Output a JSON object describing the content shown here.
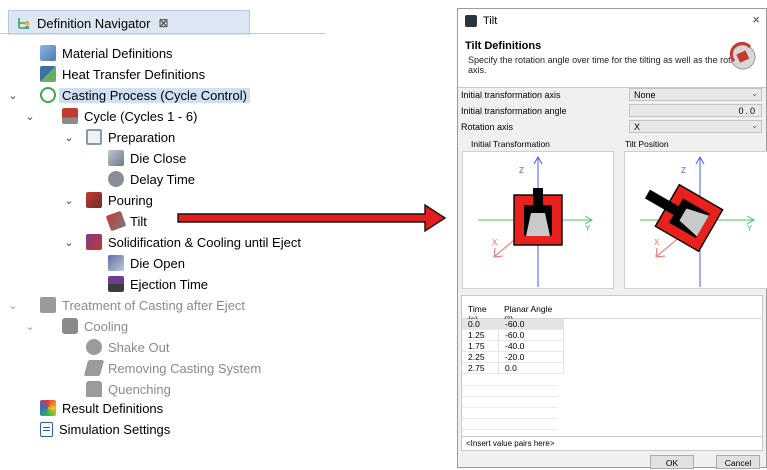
{
  "navigator": {
    "tab_title": "Definition Navigator",
    "tab_close": "⊠",
    "items": [
      {
        "label": "Material Definitions",
        "icon": "material-icon"
      },
      {
        "label": "Heat Transfer Definitions",
        "icon": "heat-transfer-icon"
      },
      {
        "label": "Casting Process (Cycle Control)",
        "icon": "casting-process-icon",
        "selected": true
      },
      {
        "label": "Cycle (Cycles 1 - 6)",
        "icon": "cycle-icon"
      },
      {
        "label": "Preparation",
        "icon": "preparation-icon"
      },
      {
        "label": "Die Close",
        "icon": "die-close-icon"
      },
      {
        "label": "Delay Time",
        "icon": "delay-time-icon"
      },
      {
        "label": "Pouring",
        "icon": "pouring-icon"
      },
      {
        "label": "Tilt",
        "icon": "tilt-icon"
      },
      {
        "label": "Solidification & Cooling until Eject",
        "icon": "solidification-icon"
      },
      {
        "label": "Die Open",
        "icon": "die-open-icon"
      },
      {
        "label": "Ejection Time",
        "icon": "ejection-time-icon"
      },
      {
        "label": "Treatment of Casting after Eject",
        "icon": "treatment-icon",
        "disabled": true
      },
      {
        "label": "Cooling",
        "icon": "cooling-icon",
        "disabled": true
      },
      {
        "label": "Shake Out",
        "icon": "shake-out-icon",
        "disabled": true
      },
      {
        "label": "Removing Casting System",
        "icon": "removing-casting-icon",
        "disabled": true
      },
      {
        "label": "Quenching",
        "icon": "quenching-icon",
        "disabled": true
      },
      {
        "label": "Result Definitions",
        "icon": "result-definitions-icon"
      },
      {
        "label": "Simulation Settings",
        "icon": "simulation-settings-icon"
      }
    ]
  },
  "arrow": {
    "color": "#e41e1e"
  },
  "dialog": {
    "title": "Tilt",
    "close": "×",
    "header_title": "Tilt Definitions",
    "header_desc": "Specify the rotation angle over time for the tilting as well as the rotation axis.",
    "fields": {
      "initial_axis_label": "Initial transformation axis",
      "initial_axis_value": "None",
      "initial_angle_label": "Initial transformation angle",
      "initial_angle_value": "0.0",
      "rotation_axis_label": "Rotation axis",
      "rotation_axis_value": "X"
    },
    "view_initial_label": "Initial Transformation",
    "view_tilt_label": "Tilt Position",
    "axes": {
      "z": "Z",
      "y": "Y",
      "x": "X"
    },
    "table": {
      "headers": [
        "Time (s)",
        "Planar Angle (°)"
      ],
      "rows": [
        [
          "0.0",
          "-60.0"
        ],
        [
          "1.25",
          "-60.0"
        ],
        [
          "1.75",
          "-40.0"
        ],
        [
          "2.25",
          "-20.0"
        ],
        [
          "2.75",
          "0.0"
        ]
      ],
      "insert_text": "<Insert value pairs here>"
    },
    "ok_label": "OK",
    "cancel_label": "Cancel"
  }
}
